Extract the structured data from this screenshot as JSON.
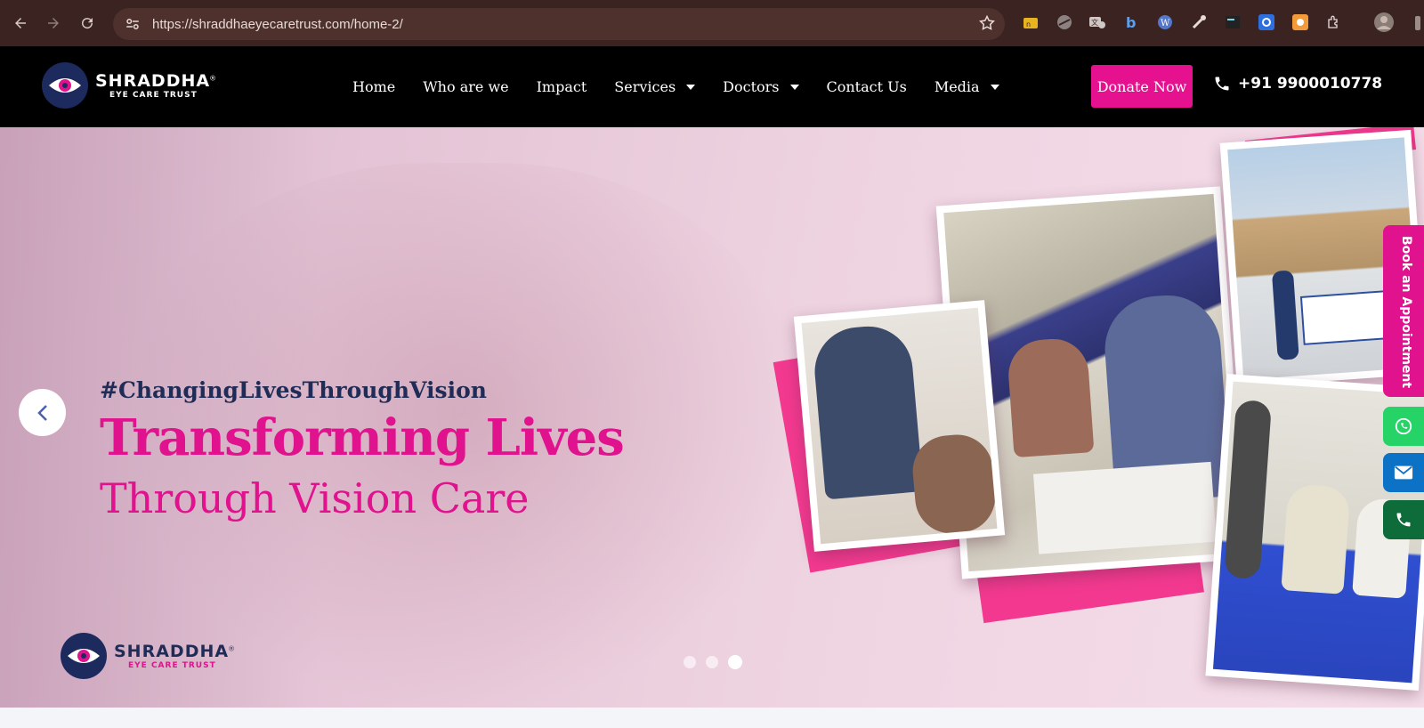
{
  "browser": {
    "url": "https://shraddhaeyecaretrust.com/home-2/",
    "nav_icons": [
      "back-arrow-icon",
      "forward-arrow-icon",
      "reload-icon"
    ],
    "extension_icons": [
      "ext-folder-icon",
      "ext-circle-icon",
      "ext-translate-icon",
      "ext-b-icon",
      "ext-wordpress-icon",
      "ext-dropper-icon",
      "ext-terminal-icon",
      "ext-gear-icon",
      "ext-orange-icon",
      "puzzle-icon",
      "profile-avatar"
    ]
  },
  "site": {
    "logo": {
      "brand": "SHRADDHA",
      "sub": "EYE CARE TRUST",
      "reg": "®"
    },
    "menu": [
      {
        "label": "Home",
        "dropdown": false
      },
      {
        "label": "Who are we",
        "dropdown": false
      },
      {
        "label": "Impact",
        "dropdown": false
      },
      {
        "label": "Services",
        "dropdown": true
      },
      {
        "label": "Doctors",
        "dropdown": true
      },
      {
        "label": "Contact Us",
        "dropdown": false
      },
      {
        "label": "Media",
        "dropdown": true
      }
    ],
    "donate_label": "Donate Now",
    "phone": "+91 9900010778"
  },
  "hero": {
    "tagline": "#ChangingLivesThroughVision",
    "headline": "Transforming Lives",
    "subline": "Through Vision Care",
    "slides_total": 3,
    "active_slide": 3,
    "logo": {
      "brand": "SHRADDHA",
      "sub": "EYE CARE TRUST",
      "reg": "®"
    }
  },
  "side_widgets": {
    "book_label": "Book an Appointment",
    "buttons": [
      "whatsapp-icon",
      "email-icon",
      "phone-icon"
    ]
  },
  "colors": {
    "brand_pink": "#e0128d",
    "brand_navy": "#1f2c57",
    "whatsapp_green": "#25d366",
    "email_blue": "#0b72c5",
    "phone_green": "#0e6b3a"
  }
}
